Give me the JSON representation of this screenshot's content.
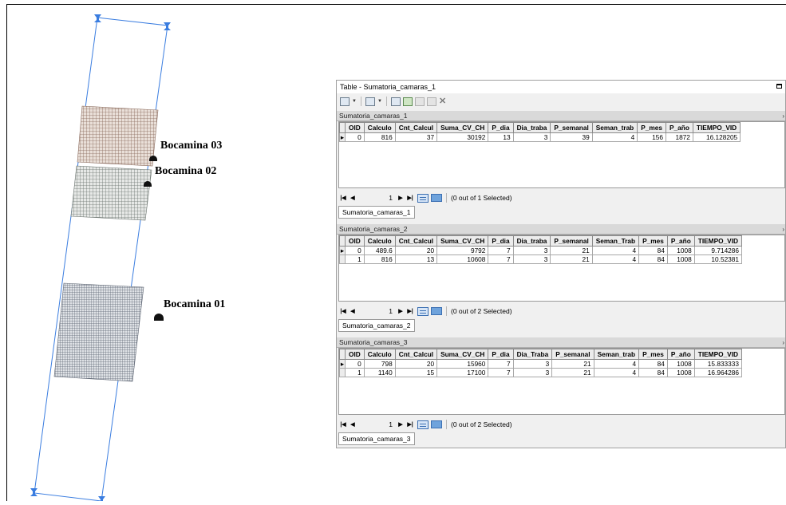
{
  "map": {
    "labels": [
      "Bocamina 03",
      "Bocamina 02",
      "Bocamina 01"
    ]
  },
  "window": {
    "title": "Table - Sumatoria_camaras_1",
    "toolbar_icons": [
      "table-options-icon",
      "related-tables-icon",
      "select-by-attributes-icon",
      "switch-selection-icon",
      "clear-selection-icon",
      "zoom-to-selected-icon",
      "delete-selected-icon"
    ]
  },
  "panels": [
    {
      "name": "Sumatoria_camaras_1",
      "columns": [
        "OID",
        "Calculo",
        "Cnt_Calcul",
        "Suma_CV_CH",
        "P_dia",
        "Dia_traba",
        "P_semanal",
        "Seman_trab",
        "P_mes",
        "P_año",
        "TIEMPO_VID"
      ],
      "rows": [
        [
          "0",
          "816",
          "37",
          "30192",
          "13",
          "3",
          "39",
          "4",
          "156",
          "1872",
          "16.128205"
        ]
      ],
      "record": "1",
      "selection": "(0 out of 1 Selected)",
      "tab": "Sumatoria_camaras_1"
    },
    {
      "name": "Sumatoria_camaras_2",
      "columns": [
        "OID",
        "Calculo",
        "Cnt_Calcul",
        "Suma_CV_CH",
        "P_dia",
        "Dia_traba",
        "P_semanal",
        "Seman_Trab",
        "P_mes",
        "P_año",
        "TIEMPO_VID"
      ],
      "rows": [
        [
          "0",
          "489.6",
          "20",
          "9792",
          "7",
          "3",
          "21",
          "4",
          "84",
          "1008",
          "9.714286"
        ],
        [
          "1",
          "816",
          "13",
          "10608",
          "7",
          "3",
          "21",
          "4",
          "84",
          "1008",
          "10.52381"
        ]
      ],
      "record": "1",
      "selection": "(0 out of 2 Selected)",
      "tab": "Sumatoria_camaras_2"
    },
    {
      "name": "Sumatoria_camaras_3",
      "columns": [
        "OID",
        "Calculo",
        "Cnt_Calcul",
        "Suma_CV_CH",
        "P_dia",
        "Dia_Traba",
        "P_semanal",
        "Seman_trab",
        "P_mes",
        "P_año",
        "TIEMPO_VID"
      ],
      "rows": [
        [
          "0",
          "798",
          "20",
          "15960",
          "7",
          "3",
          "21",
          "4",
          "84",
          "1008",
          "15.833333"
        ],
        [
          "1",
          "1140",
          "15",
          "17100",
          "7",
          "3",
          "21",
          "4",
          "84",
          "1008",
          "16.964286"
        ]
      ],
      "record": "1",
      "selection": "(0 out of 2 Selected)",
      "tab": "Sumatoria_camaras_3"
    }
  ]
}
